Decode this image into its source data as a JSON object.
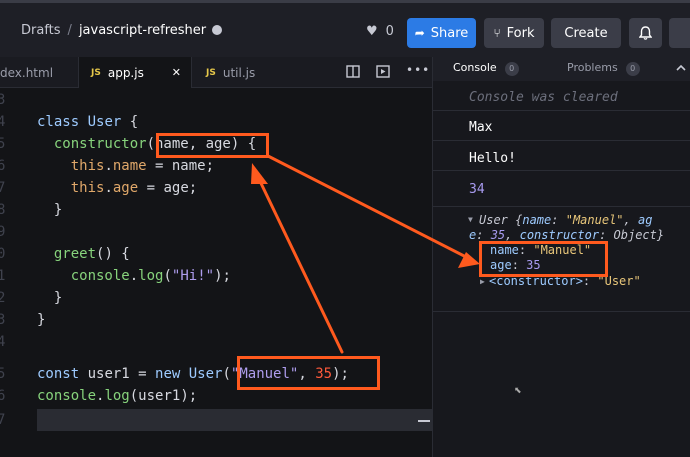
{
  "topbar": {
    "breadcrumb_root": "Drafts",
    "breadcrumb_sep": "/",
    "project_name": "javascript-refresher",
    "likes": "0",
    "share_label": "Share",
    "fork_label": "Fork",
    "create_label": "Create"
  },
  "editor": {
    "tabs": [
      {
        "label": "dex.html"
      },
      {
        "label": "app.js",
        "badge": "JS"
      },
      {
        "label": "util.js",
        "badge": "JS"
      }
    ],
    "close_glyph": "✕",
    "line_numbers": [
      "3",
      "4",
      "5",
      "6",
      "7",
      "8",
      "9",
      "0",
      "1",
      "2",
      "3",
      "4",
      "5",
      "6",
      "7"
    ]
  },
  "console": {
    "tabs": [
      {
        "label": "Console",
        "count": "0"
      },
      {
        "label": "Problems",
        "count": "0"
      }
    ],
    "cleared_message": "Console was cleared",
    "outputs": [
      "Max",
      "Hello!",
      "34"
    ],
    "object_summary": {
      "class_name": "User",
      "name_key": "name",
      "name_value": "\"Manuel\"",
      "age_key": "ag",
      "age_key_rest": "e",
      "age_value": "35",
      "ctor_key": "constructor",
      "ctor_value": "Object"
    },
    "props": [
      {
        "key": "name",
        "value": "\"Manuel\""
      },
      {
        "key": "age",
        "value": "35"
      }
    ],
    "proto": {
      "key": "<constructor>",
      "value": "\"User\""
    }
  }
}
